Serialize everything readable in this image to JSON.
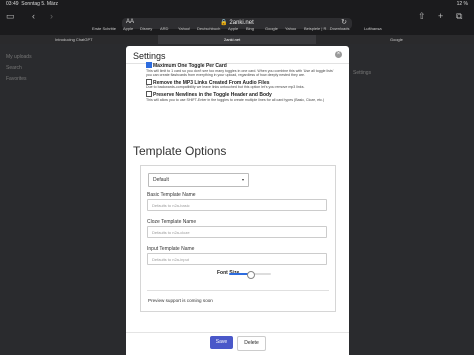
{
  "status": {
    "time": "03:49",
    "date": "Sonntag 5. März",
    "right": "12 %"
  },
  "toolbar": {
    "sidebar_icon": "sidebar-icon",
    "back_icon": "chevron-left-icon",
    "forward_icon": "chevron-right-icon",
    "share_icon": "share-icon",
    "new_tab_icon": "plus-icon",
    "tabs_icon": "tabs-icon"
  },
  "urlbar": {
    "aa": "AA",
    "host": "2anki.net",
    "reload": "↻"
  },
  "favorites": [
    "Erste Schritte",
    "Apple",
    "Disney",
    "ARD",
    "Yahoo!",
    "Deutschbuch",
    "Apple",
    "Bing",
    "Google",
    "Yahoo",
    "Beispiele | R...Downloads",
    "Lufthansa"
  ],
  "tabs": [
    {
      "label": "Introducing ChatGPT",
      "active": false
    },
    {
      "label": "2anki.net",
      "active": true
    },
    {
      "label": "Google",
      "active": false
    }
  ],
  "background": {
    "side_items": [
      "My uploads",
      "Search",
      "Favorites"
    ],
    "right_items": [
      "Settings"
    ]
  },
  "modal": {
    "title": "Settings",
    "close_icon": "close-icon",
    "options": [
      {
        "title": "Maximum One Toggle Per Card",
        "checked": true,
        "desc": "This will limit to 1 card so you don't see too many toggles in one card. When you combine this with 'Use all toggle lists' you can create flashcards from everything in your upload, regardless of how deeply nested they are."
      },
      {
        "title": "Remove the MP3 Links Created From Audio Files",
        "checked": false,
        "desc": "Due to backwards-compatibility we leave links untouched but this option let's you remove mp3 links."
      },
      {
        "title": "Preserve Newlines in the Toggle Header and Body",
        "checked": false,
        "desc": "This will allow you to use SHIFT-Enter in the toggles to create multiple lines for all card types (Basic, Cloze, etc.)"
      }
    ],
    "template_title": "Template Options",
    "select_value": "Default",
    "basic_label": "Basic Template Name",
    "basic_placeholder": "Defaults to n2a-basic",
    "cloze_label": "Cloze Template Name",
    "cloze_placeholder": "Defaults to n2a-cloze",
    "input_label": "Input Template Name",
    "input_placeholder": "Defaults to n2a-input",
    "font_size_label": "Font Size",
    "font_size_fraction": 0.5,
    "preview_text": "Preview support is coming soon",
    "save_label": "Save",
    "delete_label": "Delete"
  },
  "colors": {
    "accent": "#4a58c9",
    "check": "#2d6cdf"
  }
}
